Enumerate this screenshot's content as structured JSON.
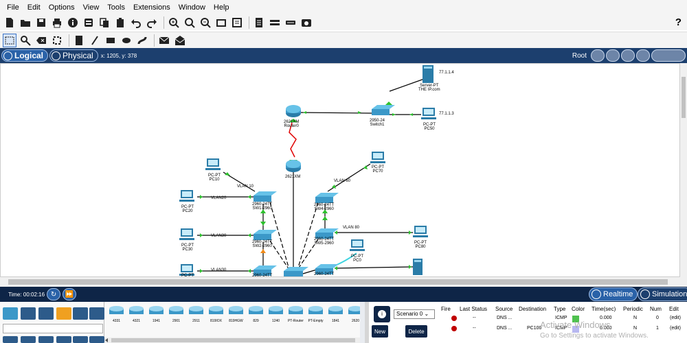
{
  "menu": [
    "File",
    "Edit",
    "Options",
    "View",
    "Tools",
    "Extensions",
    "Window",
    "Help"
  ],
  "help_label": "?",
  "tabs": {
    "logical": "Logical",
    "physical": "Physical"
  },
  "coords": "x: 1205, y: 378",
  "root_label": "Root",
  "devices": {
    "server_type": "Server-PT",
    "server_name": "THE IP.com",
    "server_ip": "77.1.1.4",
    "switch1_type": "2950-24",
    "switch1_name": "Switch1",
    "pc50_type": "PC-PT",
    "pc50_name": "PC50",
    "pc50_ip": "77.1.1.3",
    "router0_type": "2621XM",
    "router0_name": "Router0",
    "router1_type": "2621XM",
    "pc10_type": "PC-PT",
    "pc10_name": "PC10",
    "pc70_type": "PC-PT",
    "pc70_name": "PC70",
    "pc20_type": "PC-PT",
    "pc20_name": "PC20",
    "pc30_type": "PC-PT",
    "pc30_name": "PC30",
    "pc40_type": "PC-PT",
    "pc80_type": "PC-PT",
    "pc80_name": "PC80",
    "pc0_type": "PC-PT",
    "pc0_name": "PC0",
    "sw1_type": "2960-24TT",
    "sw1_name": "SW1-2960",
    "sw2_type": "2960-24TT",
    "sw2_name": "SW2-2960",
    "sw3_type": "2960-24TT",
    "sw4_type": "2960-24TT",
    "sw4_name": "SW4-2960",
    "sw5_type": "2960-24TT",
    "sw5_name": "SW5-2960",
    "sw6_type": "2960-24TT"
  },
  "vlans": {
    "v10": "VLAN 10",
    "v20": "VLAN20",
    "v30a": "VLAN30",
    "v30b": "VLAN30",
    "v60": "VLAN 60",
    "v80": "VLAN 80"
  },
  "time_label": "Time: 00:02:16",
  "realtime": "Realtime",
  "simulation": "Simulation",
  "device_models": [
    "4331",
    "4321",
    "1941",
    "2901",
    "2911",
    "819IOX",
    "819HGW",
    "829",
    "1240",
    "PT-Router",
    "PT-Empty",
    "1841",
    "2620"
  ],
  "scenario": "Scenario 0",
  "new_btn": "New",
  "delete_btn": "Delete",
  "pdu_headers": [
    "Fire",
    "Last Status",
    "Source",
    "Destination",
    "Type",
    "Color",
    "Time(sec)",
    "Periodic",
    "Num",
    "Edit"
  ],
  "pdu_rows": [
    {
      "status": "--",
      "source": "DNS ...",
      "destination": "",
      "type": "ICMP",
      "color": "#4fc24f",
      "time": "0.000",
      "periodic": "N",
      "num": "0",
      "edit": "(edit)"
    },
    {
      "status": "--",
      "source": "DNS ...",
      "destination": "PC100",
      "type": "ICMP",
      "color": "#b8b8f0",
      "time": "0.000",
      "periodic": "N",
      "num": "1",
      "edit": "(edit)"
    }
  ],
  "watermark": {
    "line1": "Activate Windows",
    "line2": "Go to Settings to activate Windows."
  }
}
